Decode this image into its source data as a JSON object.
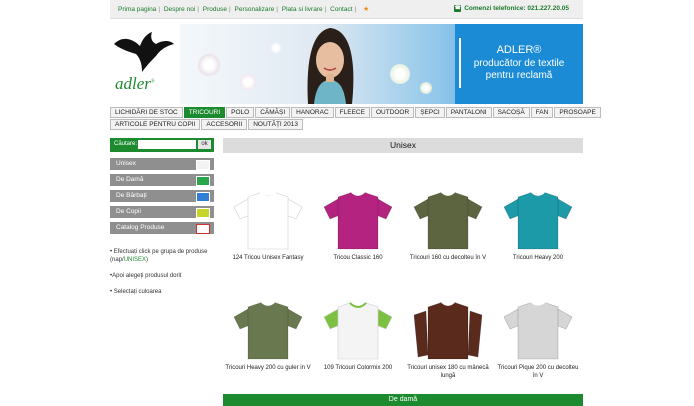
{
  "topbar": {
    "links": [
      "Prima pagina",
      "Despre noi",
      "Produse",
      "Personalizare",
      "Plata si livrare",
      "Contact"
    ],
    "phone": "Comenzi telefonice: 021.227.20.05"
  },
  "logo": {
    "text": "adler"
  },
  "banner": {
    "title": "ADLER®",
    "subtitle_1": "producător de textile",
    "subtitle_2": "pentru reclamă"
  },
  "nav": {
    "row1": [
      "LICHIDĂRI DE STOC",
      "TRICOURI",
      "POLO",
      "CĂMĂȘI",
      "HANORAC",
      "FLEECE",
      "OUTDOOR",
      "ȘEPCI",
      "PANTALONI",
      "SACOȘĂ",
      "FAN",
      "PROSOAPE"
    ],
    "row2": [
      "ARTICOLE PENTRU COPII",
      "ACCESORII",
      "NOUTĂȚI 2013"
    ],
    "active": "TRICOURI"
  },
  "search": {
    "label": "Căutare:",
    "value": "",
    "button": "ok"
  },
  "categories": [
    {
      "label": "Unisex",
      "color": "#f2f2f2"
    },
    {
      "label": "De Damă",
      "color": "#2aa64a"
    },
    {
      "label": "De Bărbați",
      "color": "#2f7fd6"
    },
    {
      "label": "De Copii",
      "color": "#c7d52a"
    },
    {
      "label": "Catalog Produse",
      "color": "#ffffff"
    }
  ],
  "instructions": {
    "line1a": "• Efectuați click pe grupa de produse (nap/",
    "line1b": "UNISEX",
    "line1c": ")",
    "line2": "•Apoi alegeți produsul dorit",
    "line3": "• Selectați culoarea"
  },
  "main": {
    "section_title": "Unisex",
    "products": [
      {
        "name": "124 Tricou Unisex Fantasy",
        "color": "#ffffff",
        "trim": "#ffffff"
      },
      {
        "name": "Tricou Classic 160",
        "color": "#b3237f",
        "trim": "#b3237f"
      },
      {
        "name": "Tricouri 160 cu decolteu în V",
        "color": "#5c6540",
        "trim": "#5c6540"
      },
      {
        "name": "Tricouri Heavy 200",
        "color": "#1c9aa8",
        "trim": "#1c9aa8"
      },
      {
        "name": "Tricouri Heavy 200 cu guler in V",
        "color": "#69784e",
        "trim": "#69784e"
      },
      {
        "name": "109 Tricouri Colormix 200",
        "color": "#f4f4f4",
        "trim": "#7cc142"
      },
      {
        "name": "Tricouri unisex 180 cu mânecă lungă",
        "color": "#5a2a1c",
        "trim": "#5a2a1c"
      },
      {
        "name": "Tricouri Pique 200 cu decolteu în V",
        "color": "#d6d6d6",
        "trim": "#d6d6d6"
      }
    ],
    "next_section": "De damă"
  }
}
